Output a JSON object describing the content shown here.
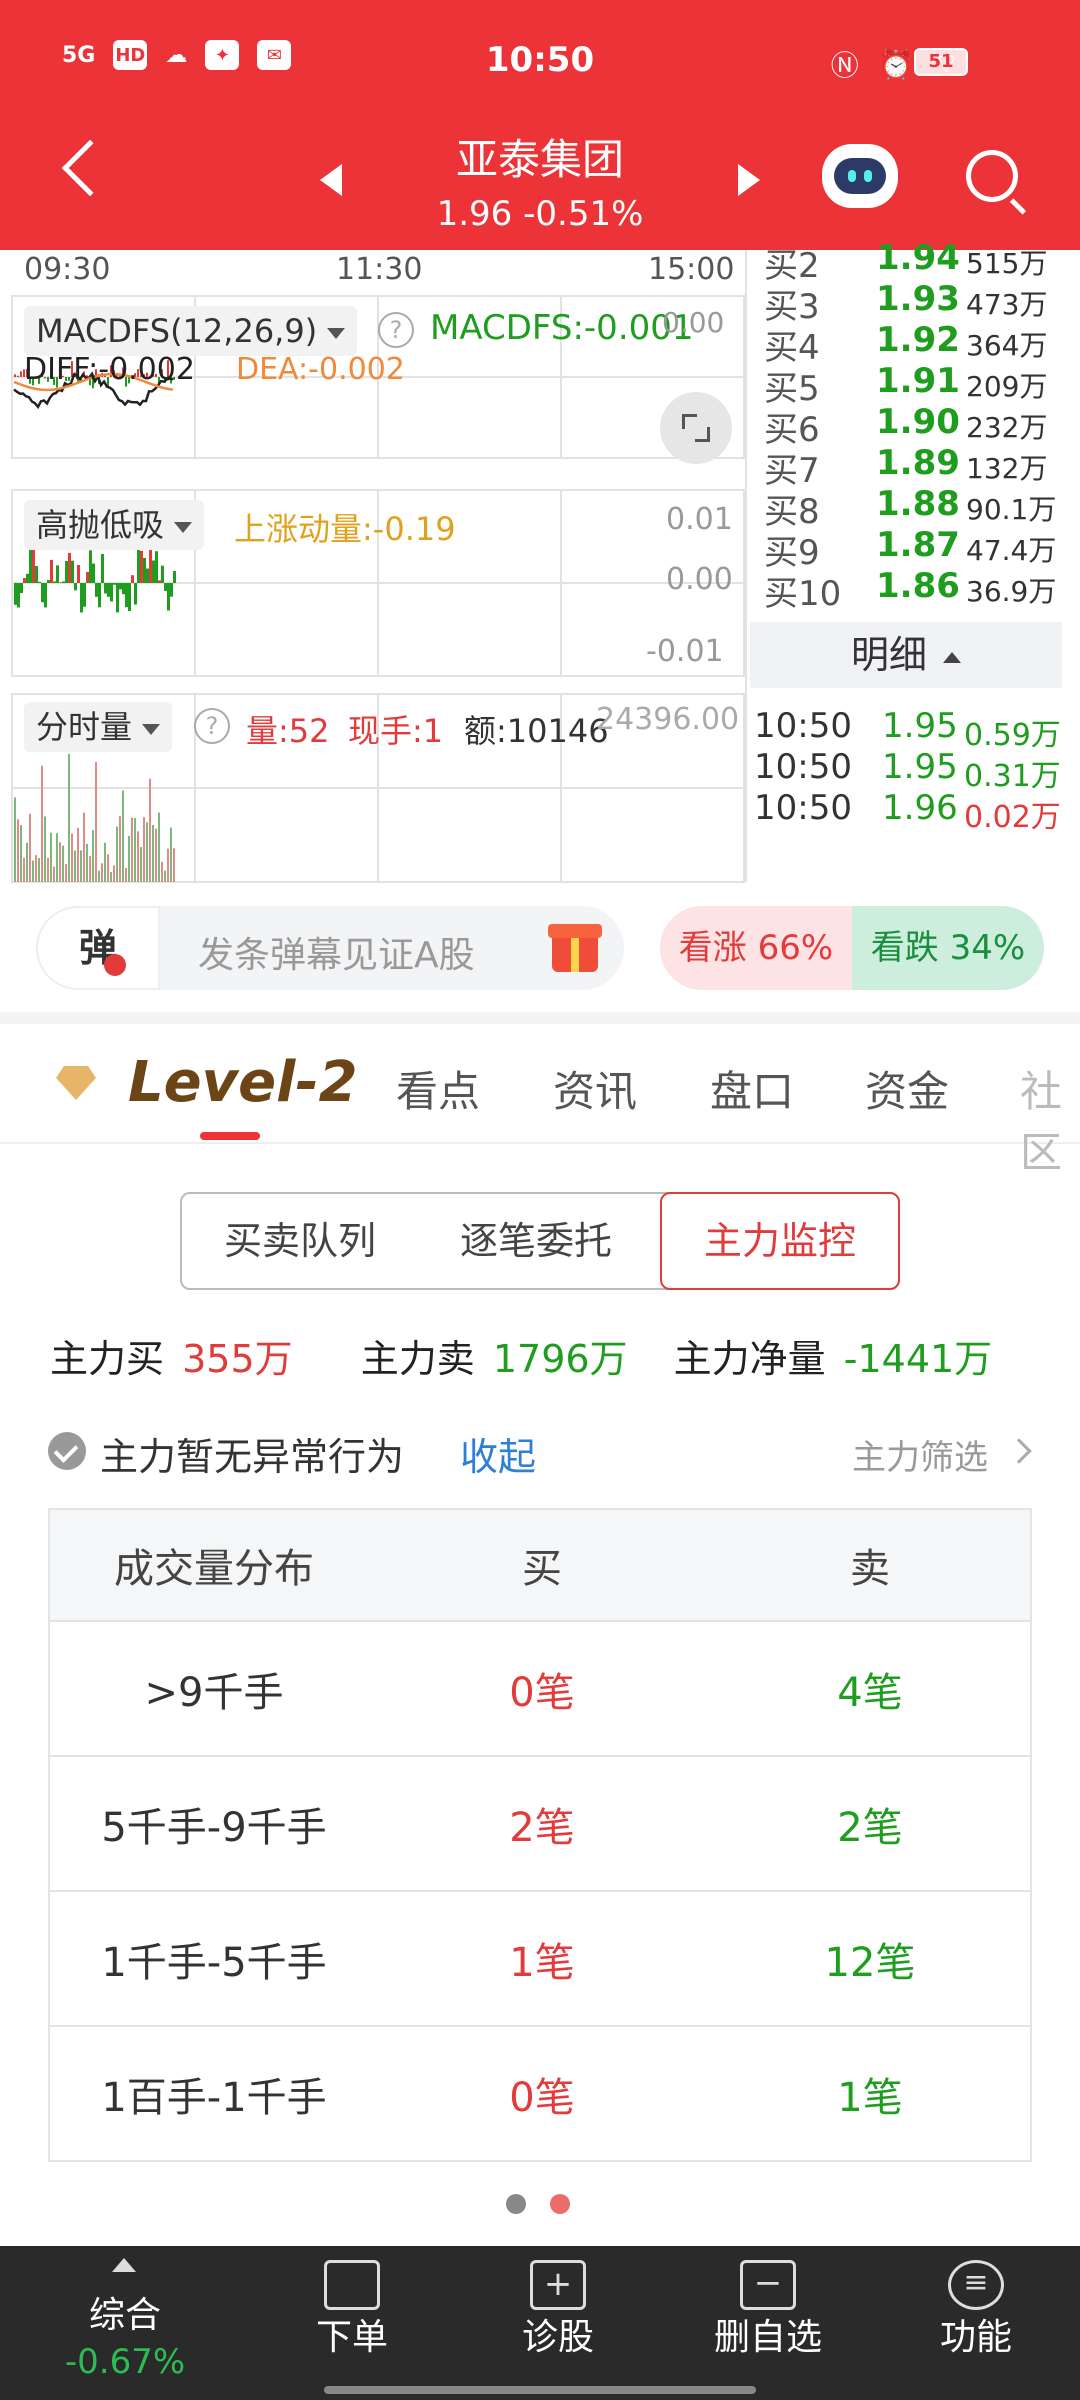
{
  "status_bar": {
    "time": "10:50",
    "network": "5G",
    "hd": "HD",
    "battery": "51"
  },
  "header": {
    "title": "亚泰集团",
    "price": "1.96",
    "change": "-0.51%"
  },
  "chart": {
    "times": [
      "09:30",
      "11:30",
      "15:00"
    ],
    "macd": {
      "name": "MACDFS(12,26,9)",
      "macdfs": "MACDFS:-0.001",
      "diff": "DIFF:-0.002",
      "dea": "DEA:-0.002",
      "top_value": "0.00"
    },
    "ggdx": {
      "name": "高抛低吸",
      "momentum": "上涨动量:-0.19",
      "axis": [
        "0.01",
        "0.00",
        "-0.01"
      ]
    },
    "volume": {
      "name": "分时量",
      "vol": "量:52",
      "hand": "现手:1",
      "amount": "额:10146",
      "axis_top": "24396.00"
    }
  },
  "order_book": [
    {
      "label": "买2",
      "price": "1.94",
      "volume": "515万"
    },
    {
      "label": "买3",
      "price": "1.93",
      "volume": "473万"
    },
    {
      "label": "买4",
      "price": "1.92",
      "volume": "364万"
    },
    {
      "label": "买5",
      "price": "1.91",
      "volume": "209万"
    },
    {
      "label": "买6",
      "price": "1.90",
      "volume": "232万"
    },
    {
      "label": "买7",
      "price": "1.89",
      "volume": "132万"
    },
    {
      "label": "买8",
      "price": "1.88",
      "volume": "90.1万"
    },
    {
      "label": "买9",
      "price": "1.87",
      "volume": "47.4万"
    },
    {
      "label": "买10",
      "price": "1.86",
      "volume": "36.9万"
    }
  ],
  "detail": {
    "title": "明细",
    "ticks": [
      {
        "time": "10:50",
        "price": "1.95",
        "volume": "0.59万",
        "color": "#1f9d1f"
      },
      {
        "time": "10:50",
        "price": "1.95",
        "volume": "0.31万",
        "color": "#1f9d1f"
      },
      {
        "time": "10:50",
        "price": "1.96",
        "volume": "0.02万",
        "color": "#e23b3b"
      }
    ]
  },
  "danmu": {
    "icon": "弹",
    "placeholder": "发条弹幕见证A股"
  },
  "vote": {
    "up": "看涨 66%",
    "down": "看跌 34%"
  },
  "tabs": {
    "level2": "Level-2",
    "items": [
      "看点",
      "资讯",
      "盘口",
      "资金",
      "社区"
    ]
  },
  "segments": [
    "买卖队列",
    "逐笔委托",
    "主力监控"
  ],
  "stats": {
    "buy_label": "主力买",
    "buy_value": "355万",
    "sell_label": "主力卖",
    "sell_value": "1796万",
    "net_label": "主力净量",
    "net_value": "-1441万"
  },
  "notice": {
    "message": "主力暂无异常行为",
    "collapse": "收起",
    "filter": "主力筛选"
  },
  "volume_table": {
    "headers": [
      "成交量分布",
      "买",
      "卖"
    ],
    "rows": [
      {
        "range": ">9千手",
        "buy": "0笔",
        "sell": "4笔"
      },
      {
        "range": "5千手-9千手",
        "buy": "2笔",
        "sell": "2笔"
      },
      {
        "range": "1千手-5千手",
        "buy": "1笔",
        "sell": "12笔"
      },
      {
        "range": "1百手-1千手",
        "buy": "0笔",
        "sell": "1笔"
      }
    ]
  },
  "bottom_nav": {
    "composite_label": "综合",
    "composite_value": "-0.67%",
    "items": [
      "下单",
      "诊股",
      "删自选",
      "功能"
    ]
  },
  "colors": {
    "brand_red": "#eb3338",
    "up": "#e23b3b",
    "down": "#1f9d1f"
  }
}
